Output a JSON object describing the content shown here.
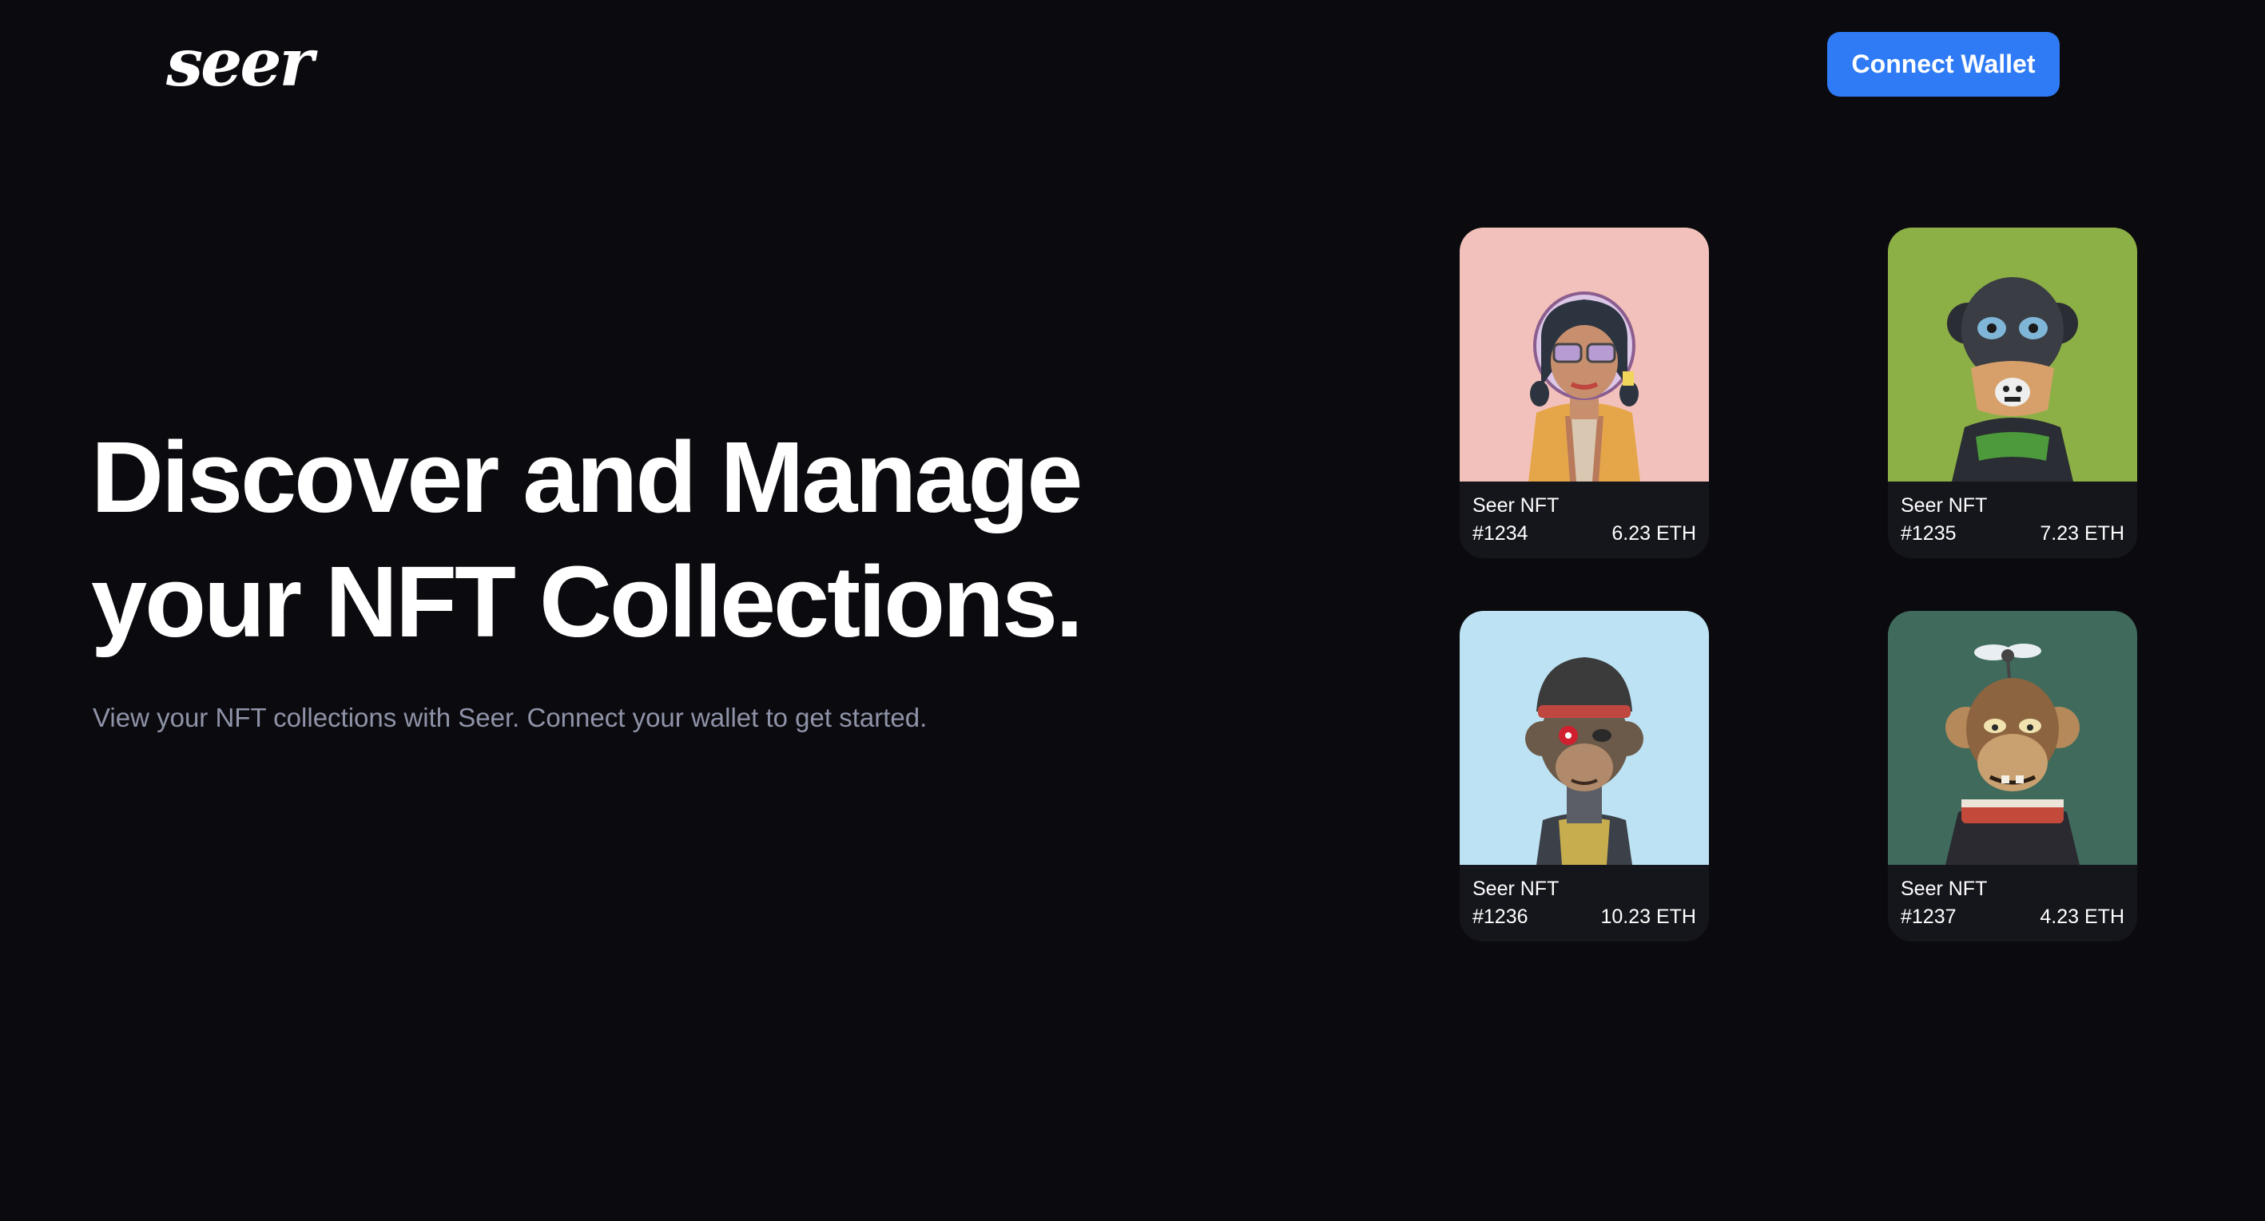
{
  "header": {
    "logo_text": "seer",
    "connect_button_label": "Connect Wallet"
  },
  "hero": {
    "title_line1": "Discover and Manage",
    "title_line2": "your NFT Collections.",
    "subtitle": "View your NFT collections with Seer. Connect your wallet to get started."
  },
  "nfts": [
    {
      "name": "Seer NFT",
      "id": "#1234",
      "price": "6.23 ETH",
      "background": "#f3c1bb",
      "art_icon": "girl-avatar-icon"
    },
    {
      "name": "Seer NFT",
      "id": "#1235",
      "price": "7.23 ETH",
      "background": "#8db046",
      "art_icon": "robot-ape-icon"
    },
    {
      "name": "Seer NFT",
      "id": "#1236",
      "price": "10.23 ETH",
      "background": "#bde2f3",
      "art_icon": "ape-beanie-icon"
    },
    {
      "name": "Seer NFT",
      "id": "#1237",
      "price": "4.23 ETH",
      "background": "#3f6a5c",
      "art_icon": "ape-propeller-icon"
    }
  ],
  "colors": {
    "page_background": "#0b0b0f",
    "accent": "#2f7bf5",
    "muted_text": "#8f93a8",
    "card_background": "#15161c"
  }
}
